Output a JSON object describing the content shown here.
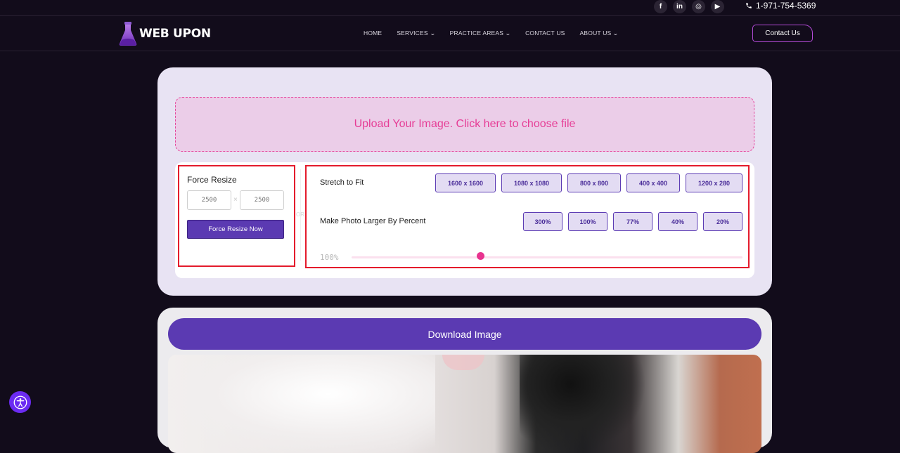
{
  "topbar": {
    "social": [
      {
        "name": "facebook",
        "glyph": "f"
      },
      {
        "name": "linkedin",
        "glyph": "in"
      },
      {
        "name": "instagram",
        "glyph": "◎"
      },
      {
        "name": "youtube",
        "glyph": "▶"
      }
    ],
    "phone": "1-971-754-5369"
  },
  "nav": {
    "logo_text": "WEB UPON",
    "links": [
      "HOME",
      "SERVICES",
      "PRACTICE AREAS",
      "CONTACT US",
      "ABOUT US"
    ],
    "contact_button": "Contact Us"
  },
  "upload": {
    "label": "Upload Your Image. Click here to choose file"
  },
  "force_resize": {
    "title": "Force Resize",
    "width_placeholder": "2500",
    "height_placeholder": "2500",
    "separator": "×",
    "button": "Force Resize Now",
    "or_text": "OR"
  },
  "stretch": {
    "label": "Stretch to Fit",
    "presets": [
      "1600 x 1600",
      "1080 x 1080",
      "800 x 800",
      "400 x 400",
      "1200 x 280"
    ]
  },
  "percent": {
    "label": "Make Photo Larger By Percent",
    "presets": [
      "300%",
      "100%",
      "77%",
      "40%",
      "20%"
    ]
  },
  "slider": {
    "value_label": "100%",
    "fraction": 0.33
  },
  "download": {
    "button": "Download Image"
  },
  "colors": {
    "accent": "#5b3ab2",
    "pink": "#e63d96",
    "highlight_box": "#e41b2c"
  }
}
